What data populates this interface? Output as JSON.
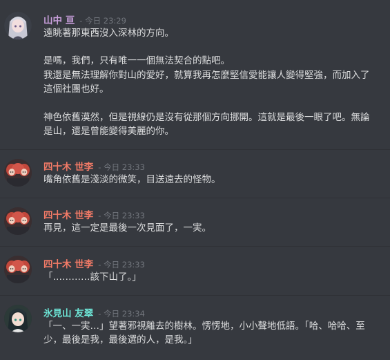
{
  "colors": {
    "background": "#36393f",
    "text": "#dcddde",
    "timestamp": "#72767d",
    "author_yamanaka": "#c9a0dc",
    "author_yosogi": "#f47b67",
    "author_himiyama": "#6ee7d8"
  },
  "messages": [
    {
      "author": "山中 亘",
      "time": "- 今日 23:29",
      "avatar": "silver-hair-girl-avatar",
      "lines": [
        "遠眺著那東西沒入深林的方向。",
        "",
        "是嗎，我們，只有唯一一個無法契合的點吧。",
        "我還是無法理解你對山的愛好，就算我再怎麼堅信愛能讓人變得堅強，而加入了",
        "這個社團也好。",
        "",
        "神色依舊漠然，但是視線仍是沒有從那個方向挪開。這就是最後一眼了吧。無論",
        "是山，還是曾能變得美麗的你。"
      ]
    },
    {
      "author": "四十木 世李",
      "time": "- 今日 23:33",
      "avatar": "red-hair-chibi-avatar",
      "lines": [
        "嘴角依舊是淺淡的微笑，目送遠去的怪物。"
      ]
    },
    {
      "author": "四十木 世李",
      "time": "- 今日 23:33",
      "avatar": "red-hair-chibi-avatar",
      "lines": [
        "再見，這一定是最後一次見面了，一実。"
      ]
    },
    {
      "author": "四十木 世李",
      "time": "- 今日 23:33",
      "avatar": "red-hair-chibi-avatar",
      "lines": [
        "「…………該下山了。」"
      ]
    },
    {
      "author": "氷見山 友翠",
      "time": "- 今日 23:34",
      "avatar": "dark-hair-boy-avatar",
      "lines": [
        "「一、一実…」望著邪視離去的樹林。愣愣地，小小聲地低語。「哈、哈哈、至",
        "少，最後是我，最後選的人，是我。」"
      ]
    }
  ]
}
